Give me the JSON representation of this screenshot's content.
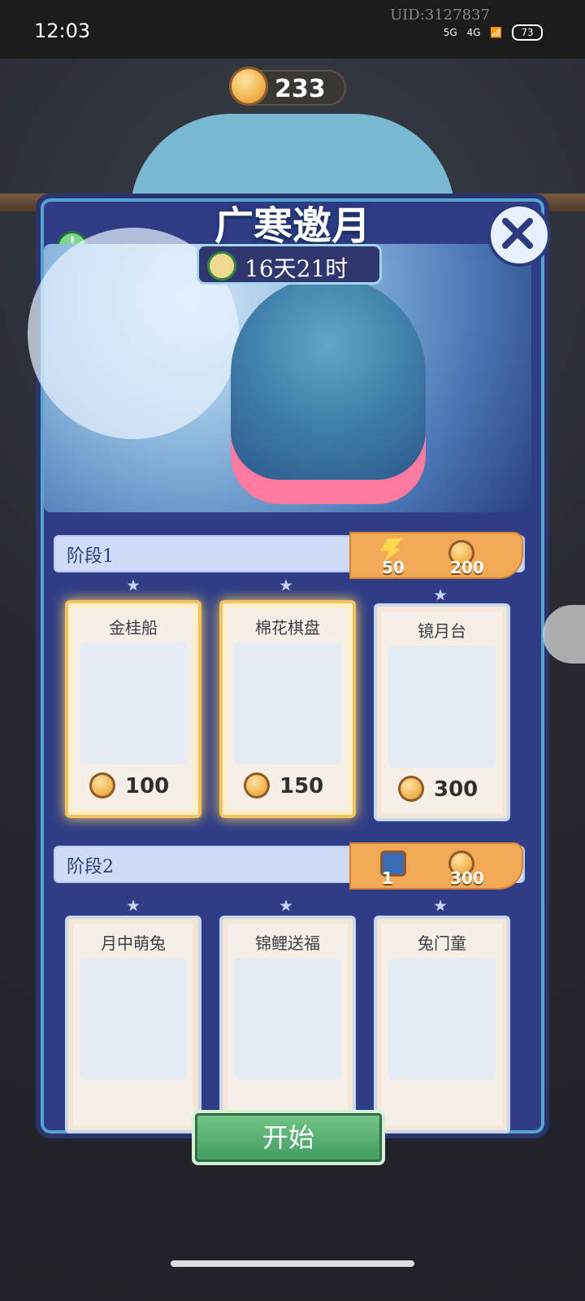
{
  "status_bar": {
    "time": "12:03",
    "uid": "UID:3127837",
    "network": [
      "5G",
      "4G"
    ],
    "battery": "73"
  },
  "header": {
    "coins": "233",
    "title": "广寒邀月",
    "timer": "16天21时"
  },
  "stage1": {
    "label": "阶段1",
    "reward_energy": "50",
    "reward_coins": "200",
    "items": [
      {
        "name": "金桂船",
        "price": "100",
        "selected": true
      },
      {
        "name": "棉花棋盘",
        "price": "150",
        "selected": true
      },
      {
        "name": "镜月台",
        "price": "300",
        "selected": false
      }
    ]
  },
  "stage2": {
    "label": "阶段2",
    "reward_tickets": "1",
    "reward_coins": "300",
    "items": [
      {
        "name": "月中萌兔"
      },
      {
        "name": "锦鲤送福"
      },
      {
        "name": "兔门童"
      }
    ]
  },
  "actions": {
    "start_label": "开始"
  },
  "colors": {
    "panel": "#2f3d86",
    "reward_orange": "#f2a955",
    "start_green": "#4aa36b"
  }
}
